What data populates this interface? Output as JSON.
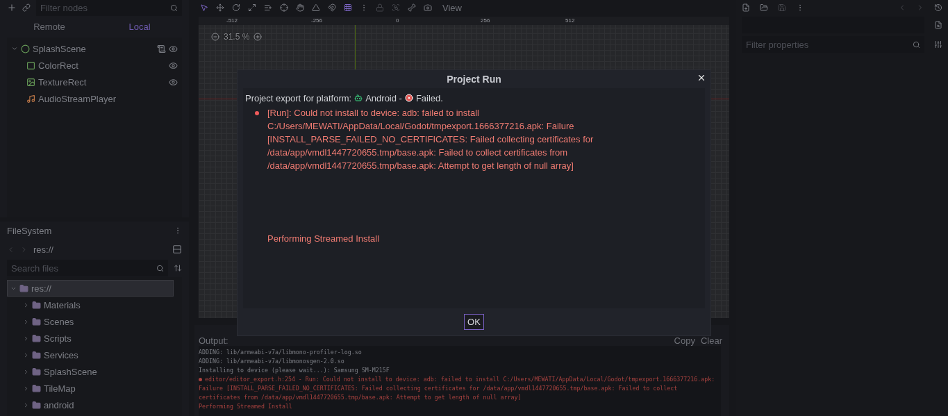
{
  "scene_dock": {
    "filter_placeholder": "Filter nodes",
    "tabs": [
      {
        "label": "Remote",
        "selected": false
      },
      {
        "label": "Local",
        "selected": true
      }
    ],
    "tree": [
      {
        "name": "SplashScene",
        "kind": "node2d",
        "script": true,
        "visibility_toggle": true,
        "expanded": true,
        "children": [
          {
            "name": "ColorRect",
            "kind": "colorrect",
            "script": false,
            "visibility_toggle": true
          },
          {
            "name": "TextureRect",
            "kind": "texturerect",
            "script": false,
            "visibility_toggle": true
          },
          {
            "name": "AudioStreamPlayer",
            "kind": "audio",
            "script": false,
            "visibility_toggle": false
          }
        ]
      }
    ]
  },
  "filesystem": {
    "title": "FileSystem",
    "path": "res://",
    "search_placeholder": "Search files",
    "tree": [
      {
        "name": "res://",
        "expanded": true,
        "selected": true,
        "children": [
          {
            "name": "Materials",
            "expanded": false,
            "selected": false
          },
          {
            "name": "Scenes",
            "expanded": false,
            "selected": false
          },
          {
            "name": "Scripts",
            "expanded": false,
            "selected": false
          },
          {
            "name": "Services",
            "expanded": false,
            "selected": false
          },
          {
            "name": "SplashScene",
            "expanded": false,
            "selected": false
          },
          {
            "name": "TileMap",
            "expanded": false,
            "selected": false
          },
          {
            "name": "android",
            "expanded": false,
            "selected": false
          }
        ]
      }
    ]
  },
  "toolbar": {
    "tools": [
      {
        "kind": "select",
        "selected": true,
        "disabled": false
      },
      {
        "kind": "move",
        "selected": false,
        "disabled": false
      },
      {
        "kind": "rotate",
        "selected": false,
        "disabled": false
      },
      {
        "kind": "scale",
        "selected": false,
        "disabled": false
      },
      {
        "kind": "list",
        "selected": false,
        "disabled": false
      },
      {
        "kind": "pivot",
        "selected": false,
        "disabled": false
      },
      {
        "kind": "pan",
        "selected": false,
        "disabled": false
      },
      {
        "kind": "ruler",
        "selected": false,
        "disabled": false
      },
      {
        "kind": "snap",
        "selected": false,
        "disabled": false
      },
      {
        "kind": "grid",
        "selected": true,
        "disabled": false
      },
      {
        "kind": "more",
        "selected": false,
        "disabled": false
      },
      {
        "kind": "lock",
        "selected": false,
        "disabled": true
      },
      {
        "kind": "group",
        "selected": false,
        "disabled": true
      },
      {
        "kind": "bone",
        "selected": false,
        "disabled": false
      },
      {
        "kind": "camera",
        "selected": false,
        "disabled": false
      }
    ],
    "menu": "View"
  },
  "viewport": {
    "zoom": "31.5 %",
    "ruler_ticks": [
      "-512",
      "-256",
      "0",
      "256",
      "512"
    ]
  },
  "inspector": {
    "filter_placeholder": "Filter properties"
  },
  "output": {
    "title": "Output:",
    "buttons": [
      "Copy",
      "Clear"
    ],
    "lines": [
      {
        "kind": "info",
        "text": "ADDING: lib/armeabi-v7a/libmono-profiler-log.so"
      },
      {
        "kind": "info",
        "text": "ADDING: lib/armeabi-v7a/libmonosgen-2.0.so"
      },
      {
        "kind": "info",
        "text": "Installing to device (please wait...): Samsung SM-M215F"
      },
      {
        "kind": "error",
        "text": "editor/editor_export.h:254 - Run: Could not install to device: adb: failed to install C:/Users/MEWATI/AppData/Local/Godot/tmpexport.1666377216.apk: Failure [INSTALL_PARSE_FAILED_NO_CERTIFICATES: Failed collecting certificates for /data/app/vmdl1447720655.tmp/base.apk: Failed to collect certificates from /data/app/vmdl1447720655.tmp/base.apk: Attempt to get length of null array]"
      },
      {
        "kind": "warning",
        "text": "Performing Streamed Install"
      }
    ]
  },
  "dialog": {
    "title": "Project Run",
    "status": {
      "prefix": "Project export for platform:",
      "platform": "Android -",
      "result": "Failed."
    },
    "messages": [
      {
        "kind": "error",
        "text": "[Run]: Could not install to device: adb: failed to install C:/Users/MEWATI/AppData/Local/Godot/tmpexport.1666377216.apk: Failure [INSTALL_PARSE_FAILED_NO_CERTIFICATES: Failed collecting certificates for /data/app/vmdl1447720655.tmp/base.apk: Failed to collect certificates from /data/app/vmdl1447720655.tmp/base.apk: Attempt to get length of null array]"
      },
      {
        "kind": "continuation",
        "text": "Performing Streamed Install"
      }
    ],
    "button": "OK"
  }
}
